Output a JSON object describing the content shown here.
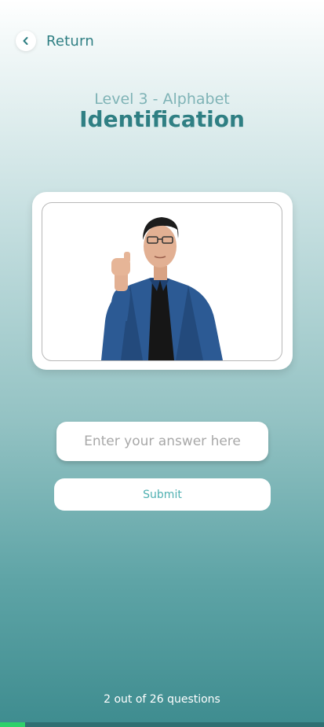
{
  "nav": {
    "return_label": "Return",
    "back_icon": "chevron-left-icon"
  },
  "header": {
    "subtitle": "Level 3 - Alphabet",
    "title": "Identification"
  },
  "media": {
    "description_icon": "sign-language-image"
  },
  "answer": {
    "placeholder": "Enter your answer here",
    "value": ""
  },
  "submit": {
    "label": "Submit"
  },
  "progress": {
    "text": "2 out of 26 questions",
    "current": 2,
    "total": 26
  },
  "colors": {
    "accent": "#2f7f83",
    "subtitle": "#7fb3b6",
    "progress_fill": "#2ed06a"
  }
}
